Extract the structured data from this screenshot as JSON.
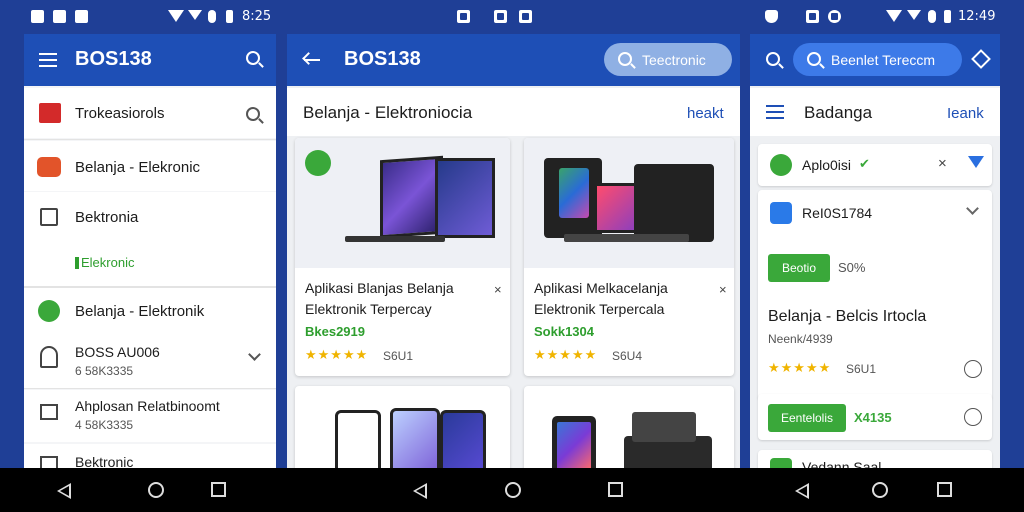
{
  "status_bar": {
    "left_time": "8:25",
    "right_time": "12:49"
  },
  "panel_left": {
    "app_title": "BOS138",
    "items": [
      {
        "label": "Trokeasiorols"
      },
      {
        "label": "Belanja - Elekronic"
      },
      {
        "label": "Bektronia"
      },
      {
        "label": "Elekronic"
      },
      {
        "label": "Belanja - Elektronik"
      },
      {
        "label": "BOSS AU006",
        "sub": "6 58K3335"
      },
      {
        "label": "Ahplosan Relatbinoomt",
        "sub": "4 58K3335"
      },
      {
        "label": "Bektronic"
      }
    ]
  },
  "panel_middle": {
    "app_title": "BOS138",
    "search_chip": "Teectronic",
    "section_title": "Belanja - Elektroniocia",
    "section_action": "heakt",
    "cards": [
      {
        "title_line1": "Aplikasi Blanjas Belanja",
        "title_line2": "Elektronik Terpercay",
        "price": "Bkes2919",
        "rating_count": "S6U1"
      },
      {
        "title_line1": "Aplikasi Melkacelanja",
        "title_line2": "Elektronik Terpercala",
        "price": "Sokk1304",
        "rating_count": "S6U4"
      }
    ]
  },
  "panel_right": {
    "search_chip": "Beenlet Tereccm",
    "section_title": "Badanga",
    "section_action": "Ieank",
    "item1_label": "Aplo0isi",
    "item2_label": "ReI0S1784",
    "promo_badge": "Beotio",
    "promo_code": "S0%",
    "product_title": "Belanja - Belcis Irtocla",
    "product_sub": "Neenk/4939",
    "rating_count": "S6U1",
    "btn2_label": "Eentelolis",
    "btn2_code": "X4135",
    "last_label": "Vedann Saal"
  },
  "colors": {
    "brand_blue": "#1e4fb6",
    "accent_green": "#3aa83a"
  }
}
